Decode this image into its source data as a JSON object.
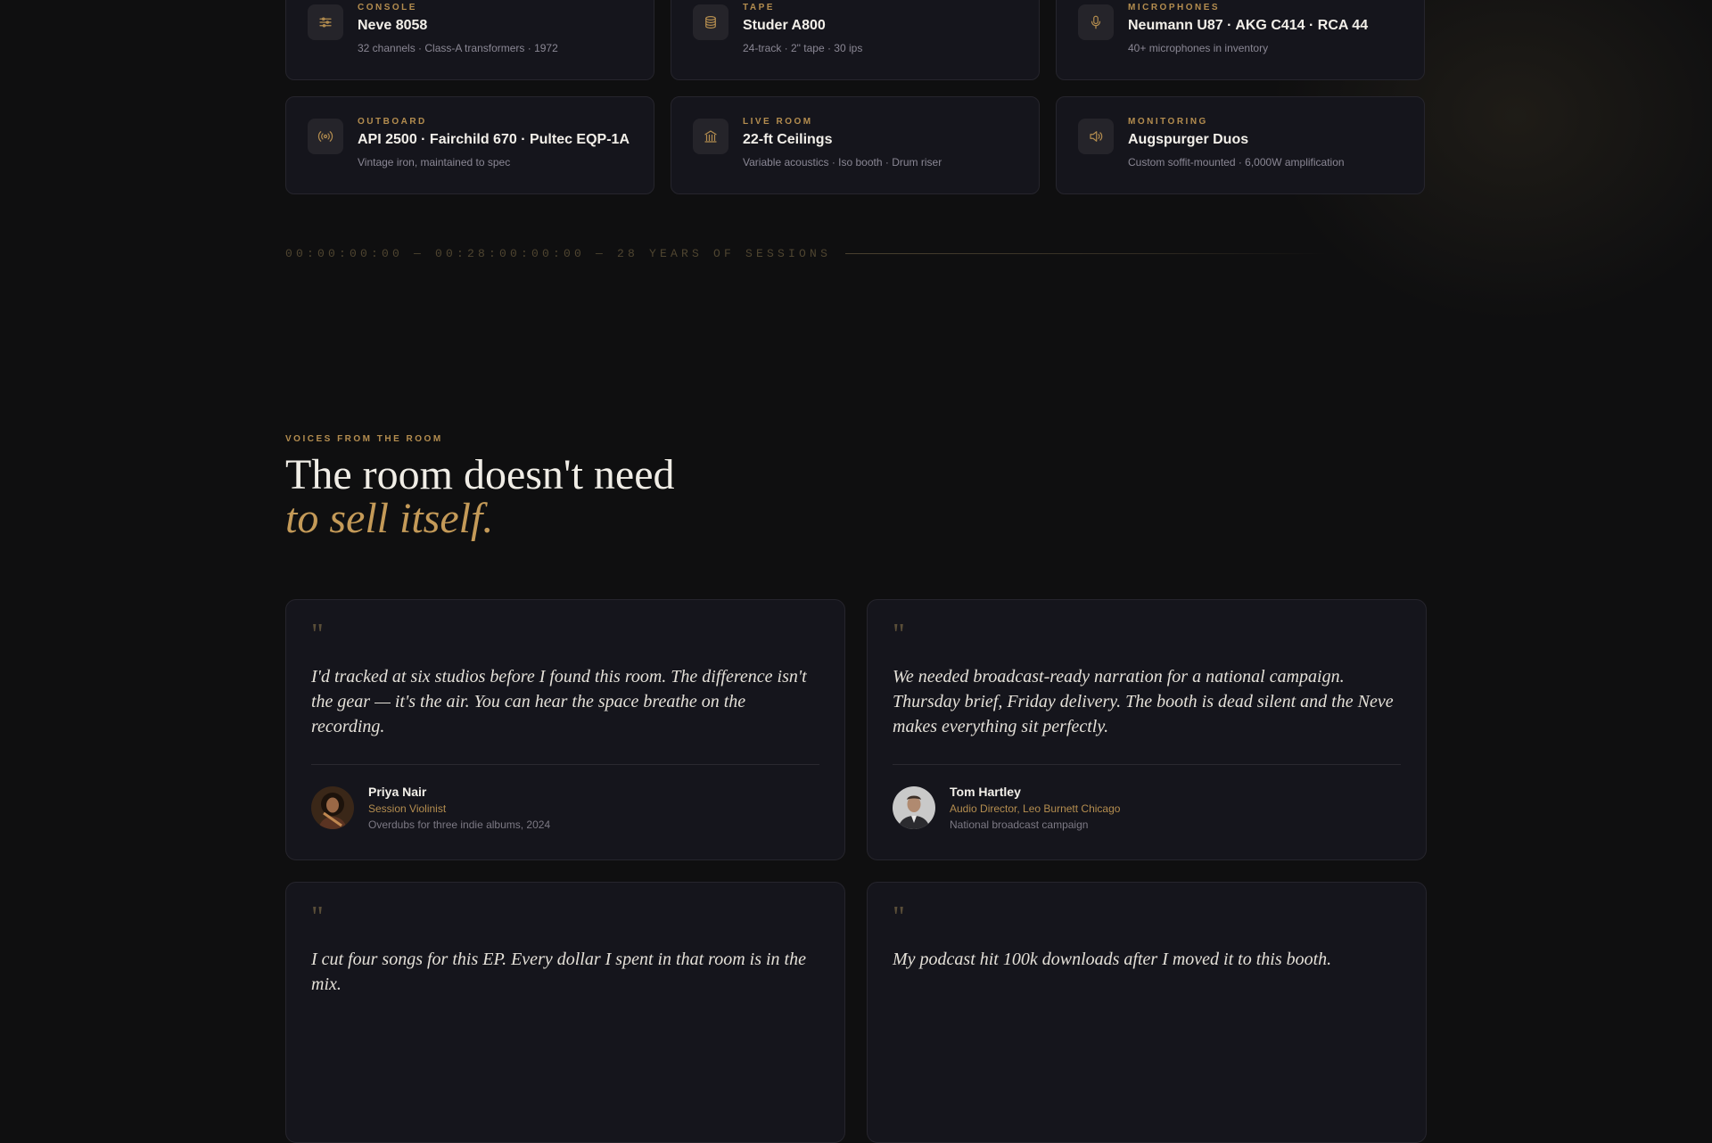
{
  "specs": [
    {
      "category": "CONSOLE",
      "title": "Neve 8058",
      "desc": "32 channels · Class-A transformers · 1972",
      "icon": "sliders-icon"
    },
    {
      "category": "TAPE",
      "title": "Studer A800",
      "desc": "24-track · 2\" tape · 30 ips",
      "icon": "tape-reel-icon"
    },
    {
      "category": "MICROPHONES",
      "title": "Neumann U87 · AKG C414 · RCA 44",
      "desc": "40+ microphones in inventory",
      "icon": "microphone-icon"
    },
    {
      "category": "OUTBOARD",
      "title": "API 2500 · Fairchild 670 · Pultec EQP-1A",
      "desc": "Vintage iron, maintained to spec",
      "icon": "broadcast-icon"
    },
    {
      "category": "LIVE ROOM",
      "title": "22-ft Ceilings",
      "desc": "Variable acoustics · Iso booth · Drum riser",
      "icon": "building-icon"
    },
    {
      "category": "MONITORING",
      "title": "Augspurger Duos",
      "desc": "Custom soffit-mounted · 6,000W amplification",
      "icon": "speaker-icon"
    }
  ],
  "timeline": {
    "text": "00:00:00:00 — 00:28:00:00:00 — 28 YEARS OF SESSIONS"
  },
  "voices": {
    "eyebrow": "VOICES FROM THE ROOM",
    "headline_line1": "The room doesn't need",
    "headline_line2": "to sell itself."
  },
  "testimonials": [
    {
      "quote_mark": "\"",
      "quote": "I'd tracked at six studios before I found this room. The difference isn't the gear — it's the air. You can hear the space breathe on the recording.",
      "name": "Priya Nair",
      "role": "Session Violinist",
      "meta": "Overdubs for three indie albums, 2024"
    },
    {
      "quote_mark": "\"",
      "quote": "We needed broadcast-ready narration for a national campaign. Thursday brief, Friday delivery. The booth is dead silent and the Neve makes everything sit perfectly.",
      "name": "Tom Hartley",
      "role": "Audio Director, Leo Burnett Chicago",
      "meta": "National broadcast campaign"
    },
    {
      "quote_mark": "\"",
      "quote": "I cut four songs for this EP. Every dollar I spent in that room is in the mix.",
      "name": "",
      "role": "",
      "meta": ""
    },
    {
      "quote_mark": "\"",
      "quote": "My podcast hit 100k downloads after I moved it to this booth.",
      "name": "",
      "role": "",
      "meta": ""
    }
  ],
  "colors": {
    "accent": "#b48d4f",
    "background": "#0f0f10",
    "card": "#15151c",
    "border": "#26252d"
  }
}
